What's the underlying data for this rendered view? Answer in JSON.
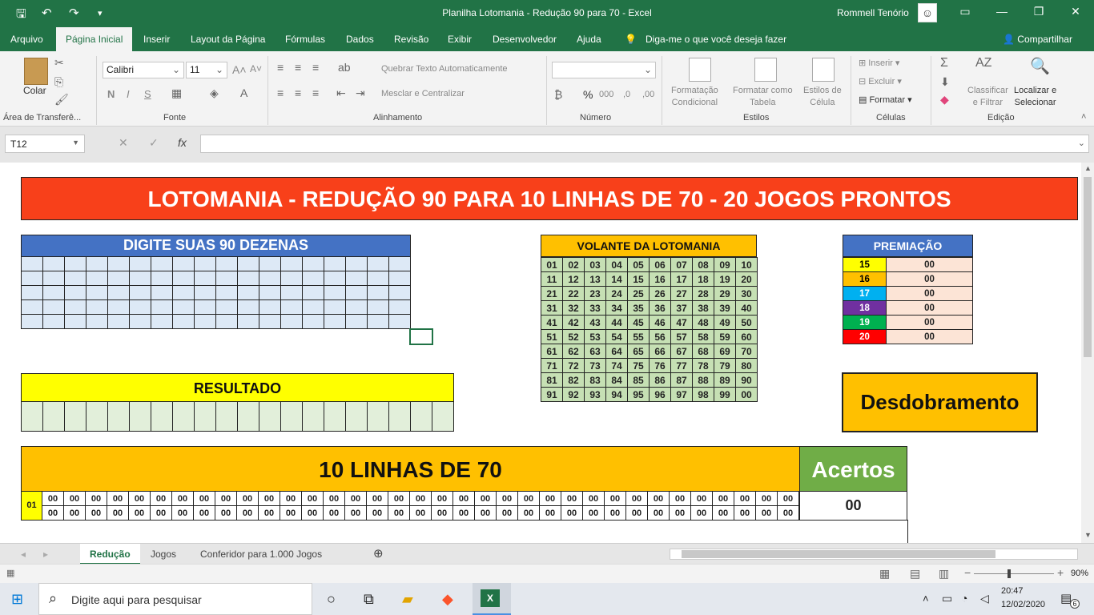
{
  "window": {
    "title": "Planilha Lotomania - Redução 90 para 70  -  Excel",
    "user": "Rommell Tenório"
  },
  "ribbon_tabs": [
    "Arquivo",
    "Página Inicial",
    "Inserir",
    "Layout da Página",
    "Fórmulas",
    "Dados",
    "Revisão",
    "Exibir",
    "Desenvolvedor",
    "Ajuda"
  ],
  "tell_me": "Diga-me o que você deseja fazer",
  "share": "Compartilhar",
  "ribbon": {
    "clipboard": {
      "paste": "Colar",
      "label": "Área de Transferê..."
    },
    "font": {
      "name": "Calibri",
      "size": "11",
      "bold": "N",
      "italic": "I",
      "underline": "S",
      "label": "Fonte"
    },
    "alignment": {
      "wrap": "Quebrar Texto Automaticamente",
      "merge": "Mesclar e Centralizar",
      "label": "Alinhamento"
    },
    "number": {
      "label": "Número",
      "percent": "%",
      "thousands": "000"
    },
    "styles": {
      "conditional": "Formatação\nCondicional",
      "as_table": "Formatar como\nTabela",
      "cell_styles": "Estilos de\nCélula",
      "label": "Estilos"
    },
    "cells": {
      "insert": "Inserir",
      "delete": "Excluir",
      "format": "Formatar",
      "label": "Células"
    },
    "editing": {
      "sort": "Classificar\ne Filtrar",
      "find": "Localizar e\nSelecionar",
      "label": "Edição"
    }
  },
  "formula_bar": {
    "name_box": "T12",
    "fx": "fx"
  },
  "sheet": {
    "banner": "LOTOMANIA - REDUÇÃO 90 PARA 10 LINHAS DE 70 - 20 JOGOS PRONTOS",
    "digite": "DIGITE SUAS 90 DEZENAS",
    "volante_title": "VOLANTE DA LOTOMANIA",
    "volante": [
      [
        "01",
        "02",
        "03",
        "04",
        "05",
        "06",
        "07",
        "08",
        "09",
        "10"
      ],
      [
        "11",
        "12",
        "13",
        "14",
        "15",
        "16",
        "17",
        "18",
        "19",
        "20"
      ],
      [
        "21",
        "22",
        "23",
        "24",
        "25",
        "26",
        "27",
        "28",
        "29",
        "30"
      ],
      [
        "31",
        "32",
        "33",
        "34",
        "35",
        "36",
        "37",
        "38",
        "39",
        "40"
      ],
      [
        "41",
        "42",
        "43",
        "44",
        "45",
        "46",
        "47",
        "48",
        "49",
        "50"
      ],
      [
        "51",
        "52",
        "53",
        "54",
        "55",
        "56",
        "57",
        "58",
        "59",
        "60"
      ],
      [
        "61",
        "62",
        "63",
        "64",
        "65",
        "66",
        "67",
        "68",
        "69",
        "70"
      ],
      [
        "71",
        "72",
        "73",
        "74",
        "75",
        "76",
        "77",
        "78",
        "79",
        "80"
      ],
      [
        "81",
        "82",
        "83",
        "84",
        "85",
        "86",
        "87",
        "88",
        "89",
        "90"
      ],
      [
        "91",
        "92",
        "93",
        "94",
        "95",
        "96",
        "97",
        "98",
        "99",
        "00"
      ]
    ],
    "premiacao_title": "PREMIAÇÃO",
    "premiacao": [
      {
        "hits": "15",
        "value": "00",
        "color": "#ffff00",
        "text": "#000000"
      },
      {
        "hits": "16",
        "value": "00",
        "color": "#ffc000",
        "text": "#000000"
      },
      {
        "hits": "17",
        "value": "00",
        "color": "#00b0f0",
        "text": "#ffffff"
      },
      {
        "hits": "18",
        "value": "00",
        "color": "#7030a0",
        "text": "#ffffff"
      },
      {
        "hits": "19",
        "value": "00",
        "color": "#00b050",
        "text": "#ffffff"
      },
      {
        "hits": "20",
        "value": "00",
        "color": "#ff0000",
        "text": "#ffffff"
      }
    ],
    "resultado": "RESULTADO",
    "desdobramento": "Desdobramento",
    "linhas_title": "10 LINHAS DE 70",
    "acertos_title": "Acertos",
    "row_label": "01",
    "cell_value": "00",
    "acertos_value": "00"
  },
  "sheet_tabs": [
    "Redução",
    "Jogos",
    "Conferidor para 1.000 Jogos"
  ],
  "status": {
    "zoom": "90%"
  },
  "taskbar": {
    "search": "Digite aqui para pesquisar",
    "time": "20:47",
    "date": "12/02/2020",
    "notif": "6"
  },
  "colors": {
    "excel_green": "#217346",
    "banner_red": "#f8401a",
    "gold": "#ffc000",
    "blue": "#4472c4",
    "acertos_green": "#70ad47"
  }
}
